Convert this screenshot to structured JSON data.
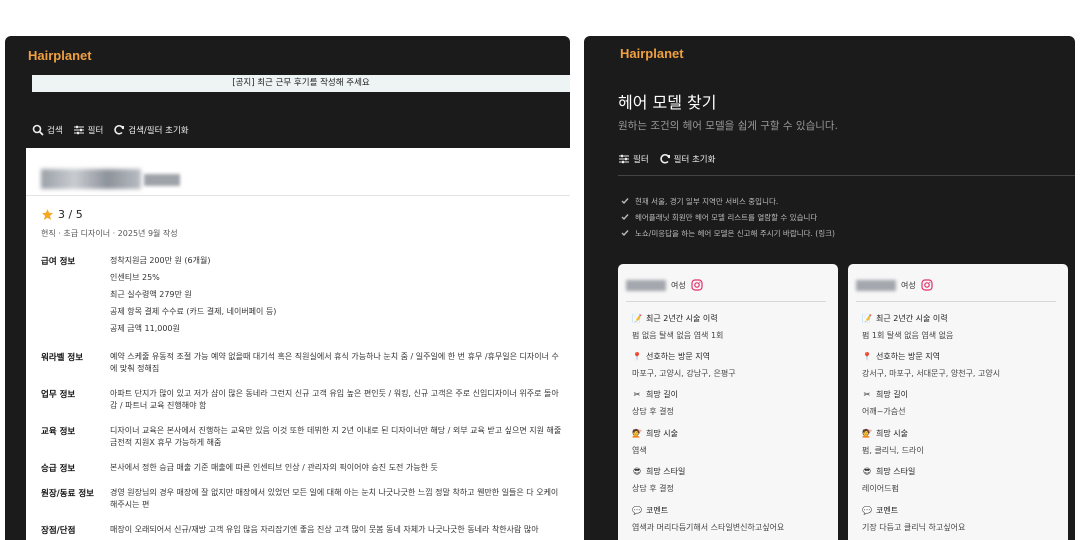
{
  "left": {
    "logo": "Hairplanet",
    "notice": "[공지] 최근 근무 후기를 작성해 주세요",
    "toolbar": {
      "search": "검색",
      "filter": "필터",
      "reset": "검색/필터 초기화"
    },
    "review": {
      "rating": "3 / 5",
      "meta": "현직 · 초급 디자이너 · 2025년 9월 작성",
      "salary": {
        "label": "급여 정보",
        "lines": [
          "정착지원금  200만 원 (6개월)",
          "인센티브  25%",
          "최근 실수령액  279만 원",
          "공제 항목  결제 수수료 (카드 결제, 네이버페이 등)",
          "공제 금액  11,000원"
        ]
      },
      "welfare": {
        "label": "워라벨 정보",
        "text": "예약 스케줄 유동적 조절 가능 예약 없을때 대기석 혹은 직원실에서 휴식 가능하나 눈치 줌 / 일주일에 한 번 휴무 /휴무일은 디자이너 수에 맞춰 정해짐"
      },
      "work": {
        "label": "업무 정보",
        "text": "아파트 단지가 많이 있고 저가 샵이 많은 동네라 그런지 신규 고객 유입 높은 편인듯 / 워킹, 신규 고객은 주로 신입디자이너 위주로 돌아감 / 파트너 교육 진행해야 함"
      },
      "edu": {
        "label": "교육 정보",
        "text": "디자이너 교육은 본사에서 진행하는 교육만 있음 이것 또한 데뷔한 지 2년 이내로 된 디자이너만 해당 / 외부 교육 받고 싶으면 지원 해줄 금전적 지원X 휴무 가능하게 해줌"
      },
      "promo": {
        "label": "승급 정보",
        "text": "본사에서 정한 승급 매출 기준 매출에 따른 인센티브 인상 / 관리자의 픽이어야 승진 도전 가능한 듯"
      },
      "director": {
        "label": "원장/동료 정보",
        "text": "경영 원장님의 경우 매장에 잘 없지만 매장에서 있었던 모든 일에 대해 아는 눈치 나긋나긋한 느낌 정말 착하고 웬만한 일들은 다 오케이 해주시는 편"
      },
      "prosCons": {
        "label": "장점/단점",
        "text": "매장이 오래되어서 신규/재방 고객 유입 많음 자리잡기엔 좋음 진상 고객 많이 뭇봄 동네 자체가 나긋나긋한 동네라 착한사람 많아"
      }
    }
  },
  "right": {
    "logo": "Hairplanet",
    "title": "헤어 모델 찾기",
    "subtitle": "원하는 조건의 헤어 모델을 쉽게 구할 수 있습니다.",
    "toolbar": {
      "filter": "필터",
      "reset": "필터 초기화"
    },
    "bullets": [
      "현재 서울, 경기 일부 지역만 서비스 중입니다.",
      "헤어플래닛 회원만 헤어 모델 리스트를 열람할 수 있습니다",
      "노쇼/미응답을 하는 헤어 모델은 신고해 주시기 바랍니다. (링크)"
    ],
    "cards": [
      {
        "gender": "여성",
        "history_label": "최근 2년간 시술 이력",
        "history": "펌 없음   탈색 없음   염색 1회",
        "area_label": "선호하는 방문 지역",
        "area": "마포구, 고양시, 강남구, 은평구",
        "length_label": "희망 길이",
        "length": "상담 후 결정",
        "treat_label": "희망 시술",
        "treat": "염색",
        "style_label": "희망 스타일",
        "style": "상담 후 결정",
        "comment_label": "코멘트",
        "comment": "염색과 머리다듬기해서 스타일변신하고싶어요"
      },
      {
        "gender": "여성",
        "history_label": "최근 2년간 시술 이력",
        "history": "펌 1회   탈색 없음   염색 없음",
        "area_label": "선호하는 방문 지역",
        "area": "강서구, 마포구, 서대문구, 양천구, 고양시",
        "length_label": "희망 길이",
        "length": "어깨~가슴선",
        "treat_label": "희망 시술",
        "treat": "펌, 클리닉, 드라이",
        "style_label": "희망 스타일",
        "style": "레이어드펌",
        "comment_label": "코멘트",
        "comment": "기장 다듬고 클리닉 하고싶어요"
      }
    ]
  },
  "colors": {
    "brand": "#f0a040",
    "panel_bg": "#1b1b1b",
    "instagram": "#e1306c",
    "star": "#f5a623"
  }
}
